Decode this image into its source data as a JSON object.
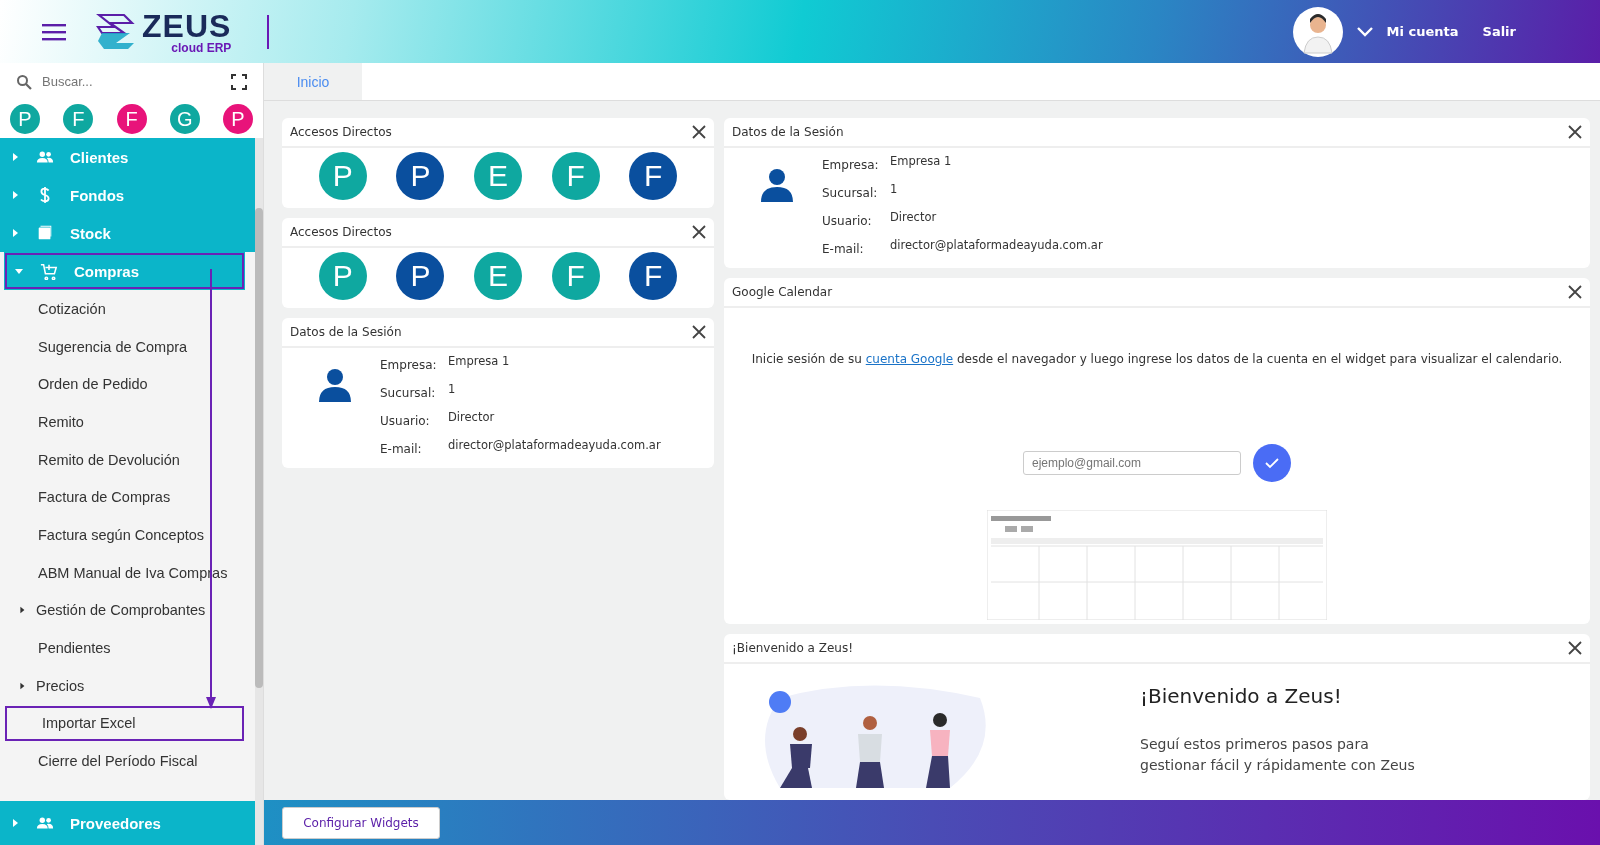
{
  "header": {
    "logo": "ZEUS",
    "logo_sub": "cloud ERP",
    "account": "Mi cuenta",
    "logout": "Salir"
  },
  "sidebar": {
    "search": {
      "placeholder": "Buscar..."
    },
    "favorites": [
      {
        "letter": "P",
        "color": "#0fa8a0"
      },
      {
        "letter": "F",
        "color": "#0fa8a0"
      },
      {
        "letter": "F",
        "color": "#e8137a"
      },
      {
        "letter": "G",
        "color": "#0fa8a0"
      },
      {
        "letter": "P",
        "color": "#e8137a"
      }
    ],
    "menu": [
      {
        "label": "Clientes",
        "expanded": false,
        "annotated": false
      },
      {
        "label": "Fondos",
        "expanded": false,
        "annotated": false
      },
      {
        "label": "Stock",
        "expanded": false,
        "annotated": false
      },
      {
        "label": "Compras",
        "expanded": true,
        "annotated": true,
        "children": [
          {
            "label": "Cotización",
            "kind": "leaf",
            "annotated": false
          },
          {
            "label": "Sugerencia de Compra",
            "kind": "leaf",
            "annotated": false
          },
          {
            "label": "Orden de Pedido",
            "kind": "leaf",
            "annotated": false
          },
          {
            "label": "Remito",
            "kind": "leaf",
            "annotated": false
          },
          {
            "label": "Remito de Devolución",
            "kind": "leaf",
            "annotated": false
          },
          {
            "label": "Factura de Compras",
            "kind": "leaf",
            "annotated": false
          },
          {
            "label": "Factura según Conceptos",
            "kind": "leaf",
            "annotated": false
          },
          {
            "label": "ABM Manual de Iva Compras",
            "kind": "leaf",
            "annotated": false
          },
          {
            "label": "Gestión de Comprobantes",
            "kind": "group",
            "annotated": false
          },
          {
            "label": "Pendientes",
            "kind": "leaf",
            "annotated": false
          },
          {
            "label": "Precios",
            "kind": "group",
            "annotated": false
          },
          {
            "label": "Importar Excel",
            "kind": "leaf",
            "annotated": true
          },
          {
            "label": "Cierre del Período Fiscal",
            "kind": "leaf",
            "annotated": false
          }
        ]
      },
      {
        "label": "Proveedores",
        "expanded": false,
        "annotated": false
      }
    ]
  },
  "tabs": [
    {
      "label": "Inicio",
      "selected": true
    }
  ],
  "left_widgets": [
    {
      "kind": "shortcuts",
      "title": "Accesos Directos",
      "items": [
        {
          "letter": "P",
          "color": "#0fa8a0"
        },
        {
          "letter": "P",
          "color": "#0a4f9e"
        },
        {
          "letter": "E",
          "color": "#0fa8a0"
        },
        {
          "letter": "F",
          "color": "#0fa8a0"
        },
        {
          "letter": "F",
          "color": "#0a4f9e"
        }
      ]
    },
    {
      "kind": "shortcuts",
      "title": "Accesos Directos",
      "items": [
        {
          "letter": "P",
          "color": "#0fa8a0"
        },
        {
          "letter": "P",
          "color": "#0a4f9e"
        },
        {
          "letter": "E",
          "color": "#0fa8a0"
        },
        {
          "letter": "F",
          "color": "#0fa8a0"
        },
        {
          "letter": "F",
          "color": "#0a4f9e"
        }
      ]
    },
    {
      "kind": "session",
      "title": "Datos de la Sesión",
      "fields": [
        {
          "label": "Empresa:",
          "value": "Empresa 1"
        },
        {
          "label": "Sucursal:",
          "value": "1"
        },
        {
          "label": "Usuario:",
          "value": "Director"
        },
        {
          "label": "E-mail:",
          "value": "director@plataformadeayuda.com.ar"
        }
      ]
    }
  ],
  "right_widgets": [
    {
      "kind": "session",
      "title": "Datos de la Sesión",
      "fields": [
        {
          "label": "Empresa:",
          "value": "Empresa 1"
        },
        {
          "label": "Sucursal:",
          "value": "1"
        },
        {
          "label": "Usuario:",
          "value": "Director"
        },
        {
          "label": "E-mail:",
          "value": "director@plataformadeayuda.com.ar"
        }
      ]
    },
    {
      "kind": "calendar",
      "title": "Google Calendar",
      "text_before": "Inicie sesión de su",
      "link": "cuenta Google",
      "text_after": "desde el navegador y luego ingrese los datos de la cuenta en el widget para visualizar el calendario.",
      "email": {
        "placeholder": "ejemplo@gmail.com"
      }
    },
    {
      "kind": "welcome",
      "title": "¡Bienvenido a Zeus!",
      "heading": "¡Bienvenido a Zeus!",
      "text": "Seguí estos primeros pasos para gestionar fácil y rápidamente con Zeus"
    }
  ],
  "footer": {
    "button": "Configurar Widgets"
  }
}
